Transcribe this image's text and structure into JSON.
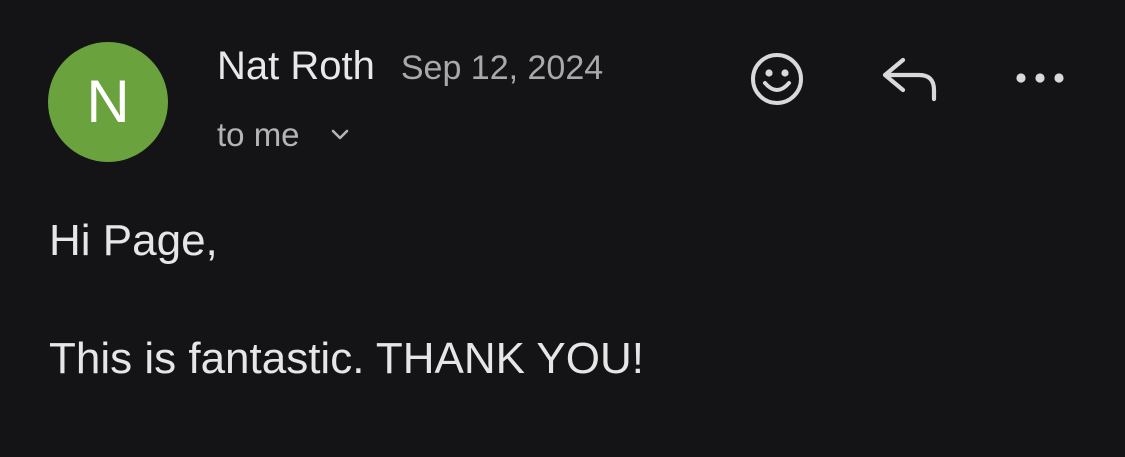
{
  "email": {
    "avatar_initial": "N",
    "sender_name": "Nat Roth",
    "date": "Sep 12, 2024",
    "recipient": "to me",
    "body": {
      "greeting": "Hi Page,",
      "message": "This is fantastic. THANK YOU!"
    }
  },
  "actions": {
    "react_icon": "smiley-face-icon",
    "reply_icon": "reply-arrow-icon",
    "more_icon": "more-options-icon"
  },
  "colors": {
    "background": "#141416",
    "avatar": "#6aa23e",
    "primary_text": "#e6e6e6",
    "secondary_text": "#a9a9a9"
  }
}
